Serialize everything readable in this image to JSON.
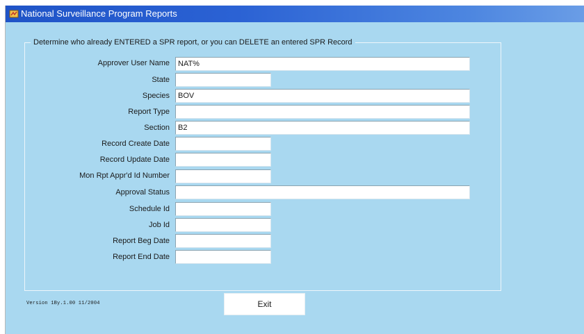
{
  "window": {
    "title": "National Surveillance Program Reports"
  },
  "form": {
    "legend": "Determine who already ENTERED a SPR report, or you can DELETE an entered SPR Record",
    "fields": [
      {
        "label": "Approver User Name",
        "value": "NAT%"
      },
      {
        "label": "State",
        "value": ""
      },
      {
        "label": "Species",
        "value": "BOV"
      },
      {
        "label": "Report Type",
        "value": ""
      },
      {
        "label": "Section",
        "value": "B2"
      },
      {
        "label": "Record Create Date",
        "value": ""
      },
      {
        "label": "Record Update Date",
        "value": ""
      },
      {
        "label": "Mon Rpt Appr'd Id Number",
        "value": ""
      },
      {
        "label": "Approval Status",
        "value": ""
      },
      {
        "label": "Schedule Id",
        "value": ""
      },
      {
        "label": "Job Id",
        "value": ""
      },
      {
        "label": "Report Beg Date",
        "value": ""
      },
      {
        "label": "Report End Date",
        "value": ""
      }
    ]
  },
  "footer": {
    "version": "Version 1By.1.00 11/2004",
    "exit_label": "Exit"
  },
  "colors": {
    "background": "#a9d8f0",
    "titlebar": "#2b62d4"
  },
  "icons": {
    "app": "app-window-icon"
  }
}
